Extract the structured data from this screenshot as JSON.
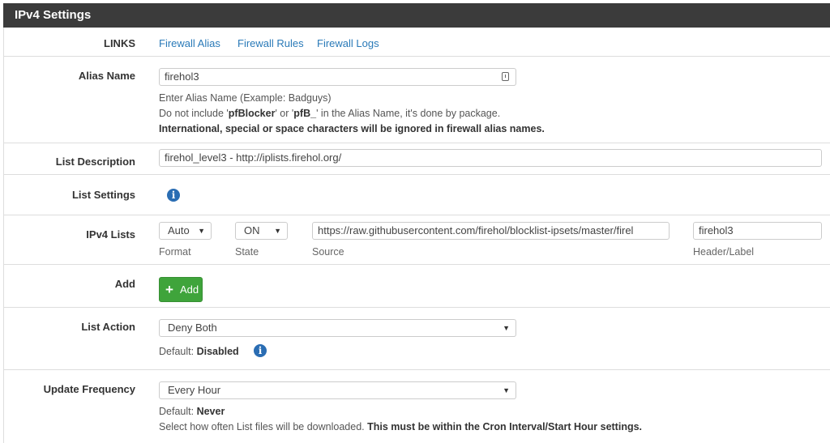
{
  "panel": {
    "title": "IPv4 Settings"
  },
  "links": {
    "label": "LINKS",
    "items": [
      "Firewall Alias",
      "Firewall Rules",
      "Firewall Logs"
    ]
  },
  "alias": {
    "label": "Alias Name",
    "value": "firehol3",
    "help1": "Enter Alias Name (Example: Badguys)",
    "help2_pre": "Do not include '",
    "help2_b1": "pfBlocker",
    "help2_mid": "' or '",
    "help2_b2": "pfB_",
    "help2_post": "' in the Alias Name, it's done by package.",
    "help3": "International, special or space characters will be ignored in firewall alias names."
  },
  "description": {
    "label": "List Description",
    "value": "firehol_level3 - http://iplists.firehol.org/"
  },
  "list_settings": {
    "label": "List Settings"
  },
  "ipv4_lists": {
    "label": "IPv4 Lists",
    "format_value": "Auto",
    "format_label": "Format",
    "state_value": "ON",
    "state_label": "State",
    "source_value": "https://raw.githubusercontent.com/firehol/blocklist-ipsets/master/firel",
    "source_label": "Source",
    "header_value": "firehol3",
    "header_label": "Header/Label"
  },
  "add": {
    "label": "Add",
    "button": "Add"
  },
  "list_action": {
    "label": "List Action",
    "value": "Deny Both",
    "default_prefix": "Default: ",
    "default_value": "Disabled"
  },
  "update_frequency": {
    "label": "Update Frequency",
    "value": "Every Hour",
    "default_prefix": "Default: ",
    "default_value": "Never",
    "help_pre": "Select how often List files will be downloaded. ",
    "help_bold": "This must be within the Cron Interval/Start Hour settings."
  },
  "icons": {
    "info": "info-icon",
    "key": "key-icon",
    "plus": "plus-icon",
    "caret": "caret-down-icon"
  },
  "colors": {
    "header_bg": "#3b3b3b",
    "link": "#2a7ab8",
    "add_button": "#3fa43b",
    "info_icon": "#2a6db3"
  }
}
